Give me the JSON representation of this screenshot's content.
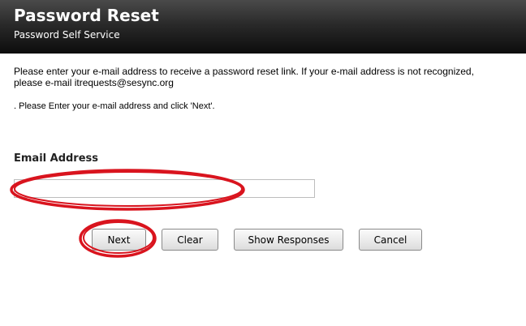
{
  "header": {
    "title": "Password Reset",
    "subtitle": "Password Self Service"
  },
  "intro": {
    "line1": "Please enter your e-mail address to receive a password reset link. If your e-mail address is not recognized,",
    "line2": "please e-mail itrequests@sesync.org"
  },
  "instruction": ". Please Enter your e-mail address and click 'Next'.",
  "form": {
    "email_label": "Email Address",
    "email_value": "",
    "email_placeholder": ""
  },
  "buttons": {
    "next": "Next",
    "clear": "Clear",
    "show_responses": "Show Responses",
    "cancel": "Cancel"
  },
  "annotation_color": "#d9141e"
}
